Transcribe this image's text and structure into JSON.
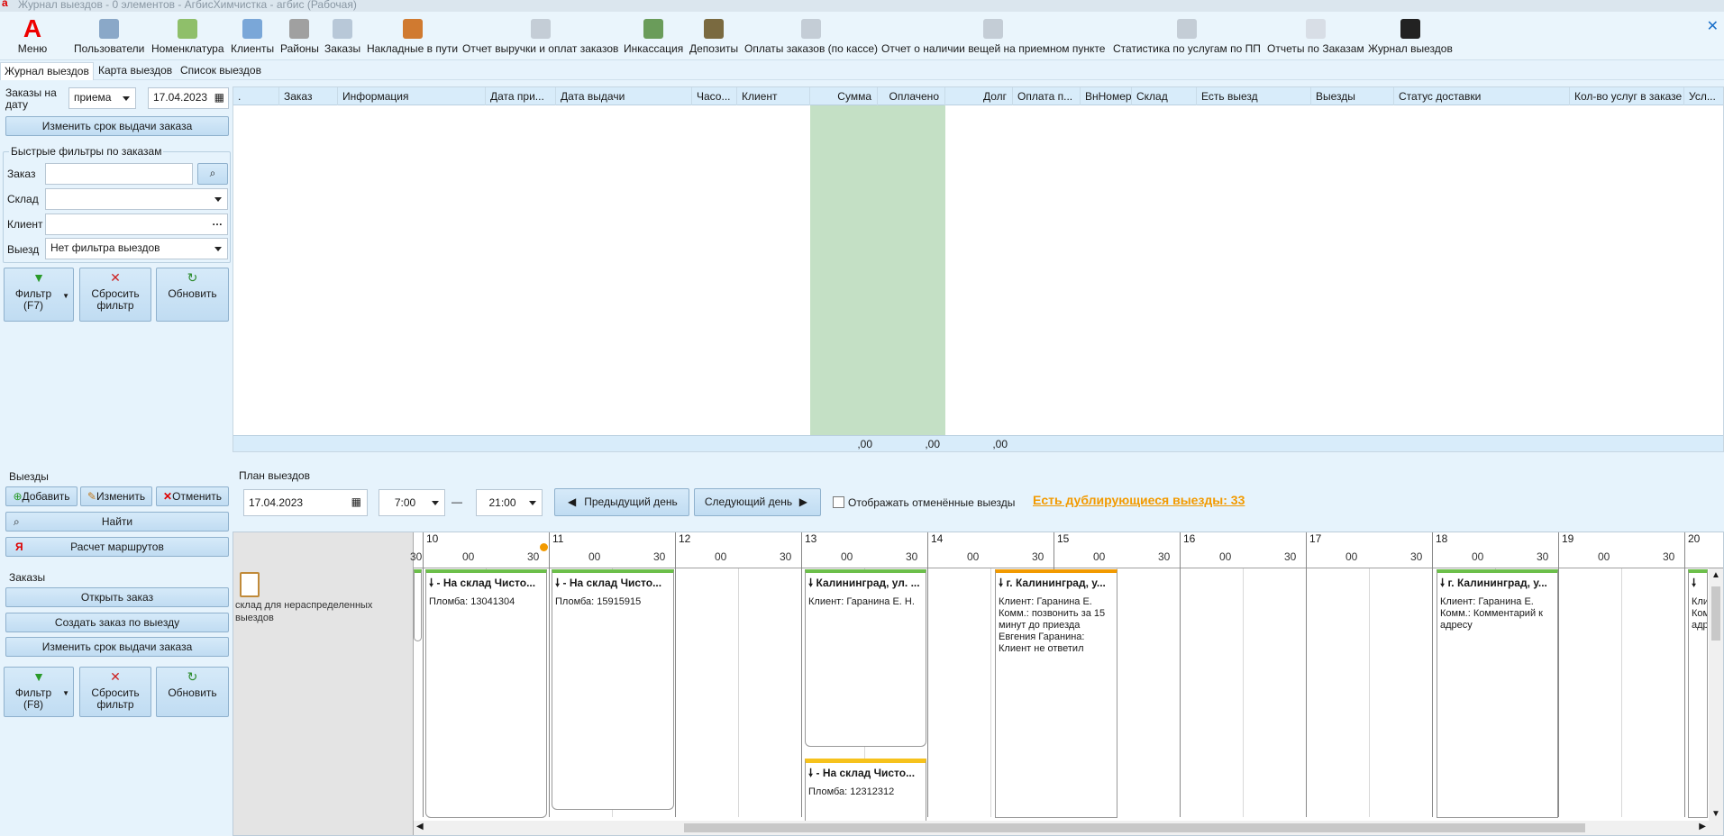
{
  "window": {
    "title": "Журнал выездов - 0 элементов - АгбисХимчистка - агбис (Рабочая)"
  },
  "toolbar": {
    "menu": "Меню",
    "items": [
      "Пользователи",
      "Номенклатура",
      "Клиенты",
      "Районы",
      "Заказы",
      "Накладные в пути",
      "Отчет выручки и оплат заказов",
      "Инкассация",
      "Депозиты",
      "Оплаты заказов (по кассе)",
      "Отчет о наличии вещей на приемном пункте",
      "Статистика по услугам по ПП",
      "Отчеты по Заказам",
      "Журнал выездов"
    ]
  },
  "tabs": [
    "Журнал выездов",
    "Карта выездов",
    "Список выездов"
  ],
  "filter": {
    "date_label": "Заказы на дату",
    "mode": "приема",
    "date": "17.04.2023",
    "change_term": "Изменить срок выдачи заказа",
    "quick_title": "Быстрые фильтры по заказам",
    "order_label": "Заказ",
    "warehouse_label": "Склад",
    "client_label": "Клиент",
    "trip_label": "Выезд",
    "trip_value": "Нет фильтра выездов",
    "filter_btn": "Фильтр (F7)",
    "reset_btn": "Сбросить фильтр",
    "refresh_btn": "Обновить"
  },
  "grid": {
    "columns": [
      ".",
      "Заказ",
      "Информация",
      "Дата при...",
      "Дата выдачи",
      "Часо...",
      "Клиент",
      "Сумма",
      "Оплачено",
      "Долг",
      "Оплата п...",
      "ВнНомер",
      "Склад",
      "Есть выезд",
      "Выезды",
      "Статус доставки",
      "Кол-во услуг в заказе",
      "Усл..."
    ],
    "totals": {
      "sum": ",00",
      "paid": ",00",
      "debt": ",00"
    }
  },
  "trips": {
    "title": "Выезды",
    "add": "Добавить",
    "edit": "Изменить",
    "cancel": "Отменить",
    "find": "Найти",
    "routes": "Расчет маршрутов"
  },
  "orders": {
    "title": "Заказы",
    "open": "Открыть заказ",
    "create": "Создать заказ по выезду",
    "change_term": "Изменить срок выдачи заказа",
    "filter_btn": "Фильтр (F8)",
    "reset_btn": "Сбросить фильтр",
    "refresh_btn": "Обновить"
  },
  "plan": {
    "title": "План выездов",
    "date": "17.04.2023",
    "from": "7:00",
    "dash": "—",
    "to": "21:00",
    "prev": "Предыдущий день",
    "next": "Следующий день",
    "show_cancelled": "Отображать отменённые выезды",
    "duplicates": "Есть дублирующиеся выезды: 33",
    "resource": "склад для нераспределенных выездов",
    "hours": [
      "10",
      "11",
      "12",
      "13",
      "14",
      "15",
      "16",
      "17",
      "18",
      "19",
      "20"
    ],
    "half_labels": [
      "00",
      "30"
    ],
    "cards": [
      {
        "title": "- На склад Чисто...",
        "body": "Пломба: 13041304"
      },
      {
        "title": "- На склад Чисто...",
        "body": "Пломба: 15915915"
      },
      {
        "title": "Калининград, ул. ...",
        "body": "Клиент: Гаранина Е. Н."
      },
      {
        "title": "- На склад Чисто...",
        "body": "Пломба: 12312312"
      },
      {
        "title": "г. Калининград, у...",
        "body": "Клиент: Гаранина Е.\nКомм.: позвонить за 15 минут до приезда\nЕвгения Гаранина: Клиент не ответил"
      },
      {
        "title": "г. Калининград, у...",
        "body": "Клиент: Гаранина Е.\nКомм.: Комментарий к адресу"
      },
      {
        "title": "",
        "body": "Кли\nКом\nадр"
      }
    ]
  },
  "colors": {
    "accent": "#1a6fc9",
    "green": "#c4e0c5",
    "card_green": "#6cbf4a",
    "card_orange": "#f29a00",
    "card_yellow": "#f6c21c",
    "link_orange": "#f29a00"
  }
}
